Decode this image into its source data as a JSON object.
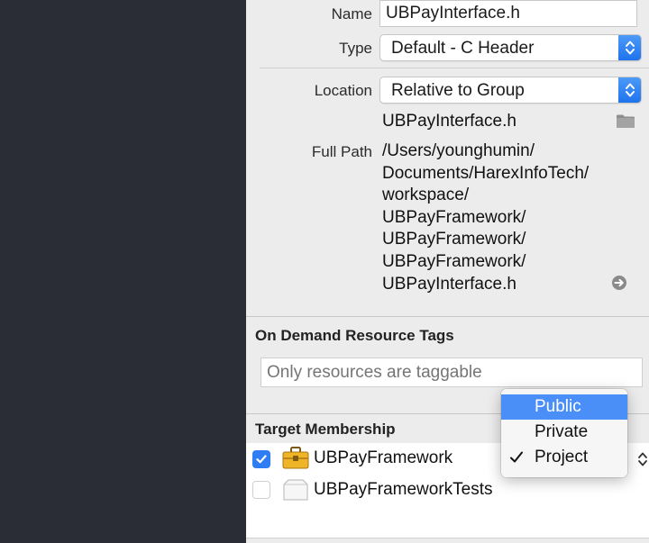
{
  "identity": {
    "name_label": "Name",
    "name_value": "UBPayInterface.h",
    "type_label": "Type",
    "type_value": "Default - C Header",
    "location_label": "Location",
    "location_value": "Relative to Group",
    "location_file": "UBPayInterface.h",
    "full_path_label": "Full Path",
    "full_path_lines": [
      "/Users/younghumin/",
      "Documents/HarexInfoTech/",
      "workspace/",
      "UBPayFramework/",
      "UBPayFramework/",
      "UBPayFramework/",
      "UBPayInterface.h"
    ]
  },
  "odr": {
    "title": "On Demand Resource Tags",
    "placeholder": "Only resources are taggable"
  },
  "target_membership": {
    "title": "Target Membership",
    "targets": [
      {
        "label": "UBPayFramework",
        "checked": true,
        "icon": "toolbox-icon"
      },
      {
        "label": "UBPayFrameworkTests",
        "checked": false,
        "icon": "test-bundle-icon"
      }
    ]
  },
  "visibility_menu": {
    "items": [
      "Public",
      "Private",
      "Project"
    ],
    "highlighted": "Public",
    "checked": "Project"
  },
  "colors": {
    "accent": "#2f7df5",
    "sidebar": "#2a2d36",
    "inspector_bg": "#ececec",
    "menu_highlight": "#4a8ef7"
  }
}
